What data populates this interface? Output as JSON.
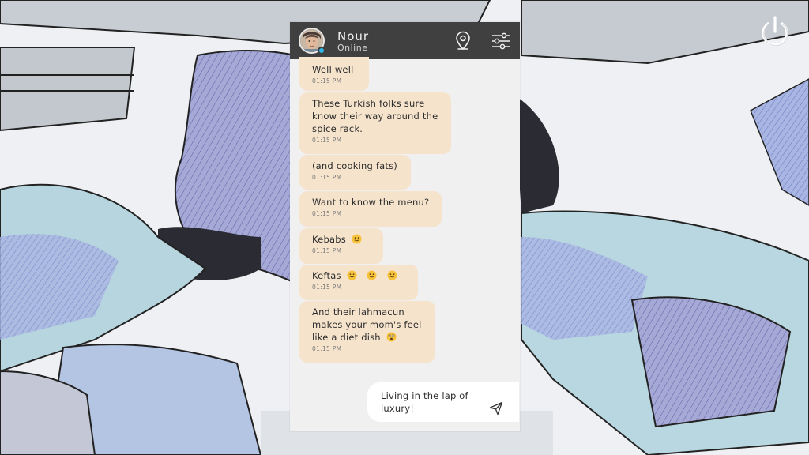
{
  "background": {
    "description_icon": "illustrated-comic-background"
  },
  "controls": {
    "power_icon": "power-icon"
  },
  "chat": {
    "contact_name": "Nour",
    "contact_status": "Online",
    "status_color": "#2eb8e8",
    "header_bg": "#404040",
    "bubble_color": "#f5e3cc",
    "icons": {
      "location": "location-pin-icon",
      "settings": "sliders-icon",
      "send": "send-icon"
    },
    "messages": [
      {
        "text": "Well well",
        "time": "01:15 PM"
      },
      {
        "text": "These Turkish folks sure",
        "text2": "know their way around the",
        "text3": "spice rack.",
        "time": "01:15 PM"
      },
      {
        "text": "(and cooking fats)",
        "time": "01:15 PM"
      },
      {
        "text": "Want to know the menu?",
        "time": "01:15 PM"
      },
      {
        "text": "Kebabs",
        "time": "01:15 PM",
        "emoji": [
          "slight-smile"
        ]
      },
      {
        "text": "Keftas",
        "time": "01:15 PM",
        "emoji": [
          "slight-smile",
          "slight-smile",
          "slight-smile"
        ]
      },
      {
        "text": "And their lahmacun",
        "text2": "makes your mom's feel",
        "text3": "like a diet dish",
        "time": "01:15 PM",
        "emoji": [
          "astonished"
        ]
      }
    ],
    "draft": {
      "line1": "Living in the lap of",
      "line2": "luxury!"
    }
  }
}
